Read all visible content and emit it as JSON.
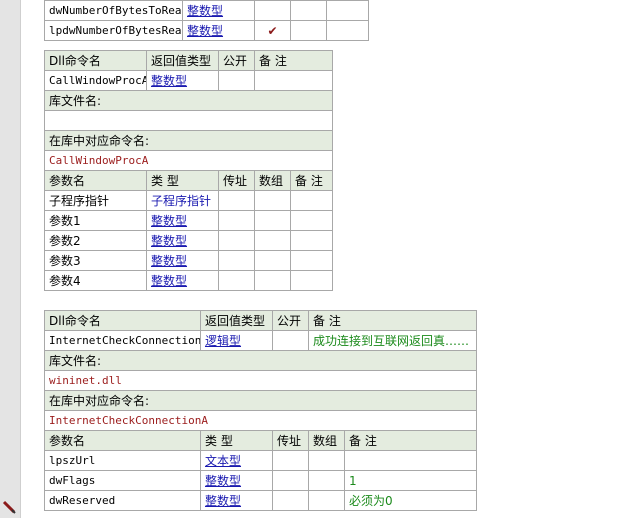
{
  "colors": {
    "header_bg": "#e4ecdf",
    "border": "#a8a8a8",
    "link": "#1a1ab0",
    "lib_text": "#9b1c1c",
    "note_text": "#1b8a1b"
  },
  "icons": {
    "check": "checkmark-icon",
    "edit": "pencil-icon"
  },
  "top_rows": [
    {
      "name": "dwNumberOfBytesToRead",
      "type": "整数型",
      "byref": "",
      "array": "",
      "note": ""
    },
    {
      "name": "lpdwNumberOfBytesRead",
      "type": "整数型",
      "byref": "✔",
      "array": "",
      "note": ""
    }
  ],
  "dll1": {
    "headers": {
      "name": "Dll命令名",
      "ret": "返回值类型",
      "public": "公开",
      "note": "备 注"
    },
    "name": "CallWindowProcA",
    "ret": "整数型",
    "public": "",
    "note": "",
    "lib_label": "库文件名:",
    "lib_value": "",
    "alias_label": "在库中对应命令名:",
    "alias_value": "CallWindowProcA",
    "param_headers": {
      "name": "参数名",
      "type": "类 型",
      "byref": "传址",
      "array": "数组",
      "note": "备 注"
    },
    "params": [
      {
        "name": "子程序指针",
        "type": "子程序指针"
      },
      {
        "name": "参数1",
        "type": "整数型"
      },
      {
        "name": "参数2",
        "type": "整数型"
      },
      {
        "name": "参数3",
        "type": "整数型"
      },
      {
        "name": "参数4",
        "type": "整数型"
      }
    ]
  },
  "dll2": {
    "headers": {
      "name": "Dll命令名",
      "ret": "返回值类型",
      "public": "公开",
      "note": "备 注"
    },
    "name": "InternetCheckConnectionA",
    "ret": "逻辑型",
    "public": "",
    "note": "成功连接到互联网返回真……",
    "lib_label": "库文件名:",
    "lib_value": "wininet.dll",
    "alias_label": "在库中对应命令名:",
    "alias_value": "InternetCheckConnectionA",
    "param_headers": {
      "name": "参数名",
      "type": "类 型",
      "byref": "传址",
      "array": "数组",
      "note": "备 注"
    },
    "params": [
      {
        "name": "lpszUrl",
        "type": "文本型",
        "note": ""
      },
      {
        "name": "dwFlags",
        "type": "整数型",
        "note": "1"
      },
      {
        "name": "dwReserved",
        "type": "整数型",
        "note": "必须为0"
      }
    ]
  }
}
